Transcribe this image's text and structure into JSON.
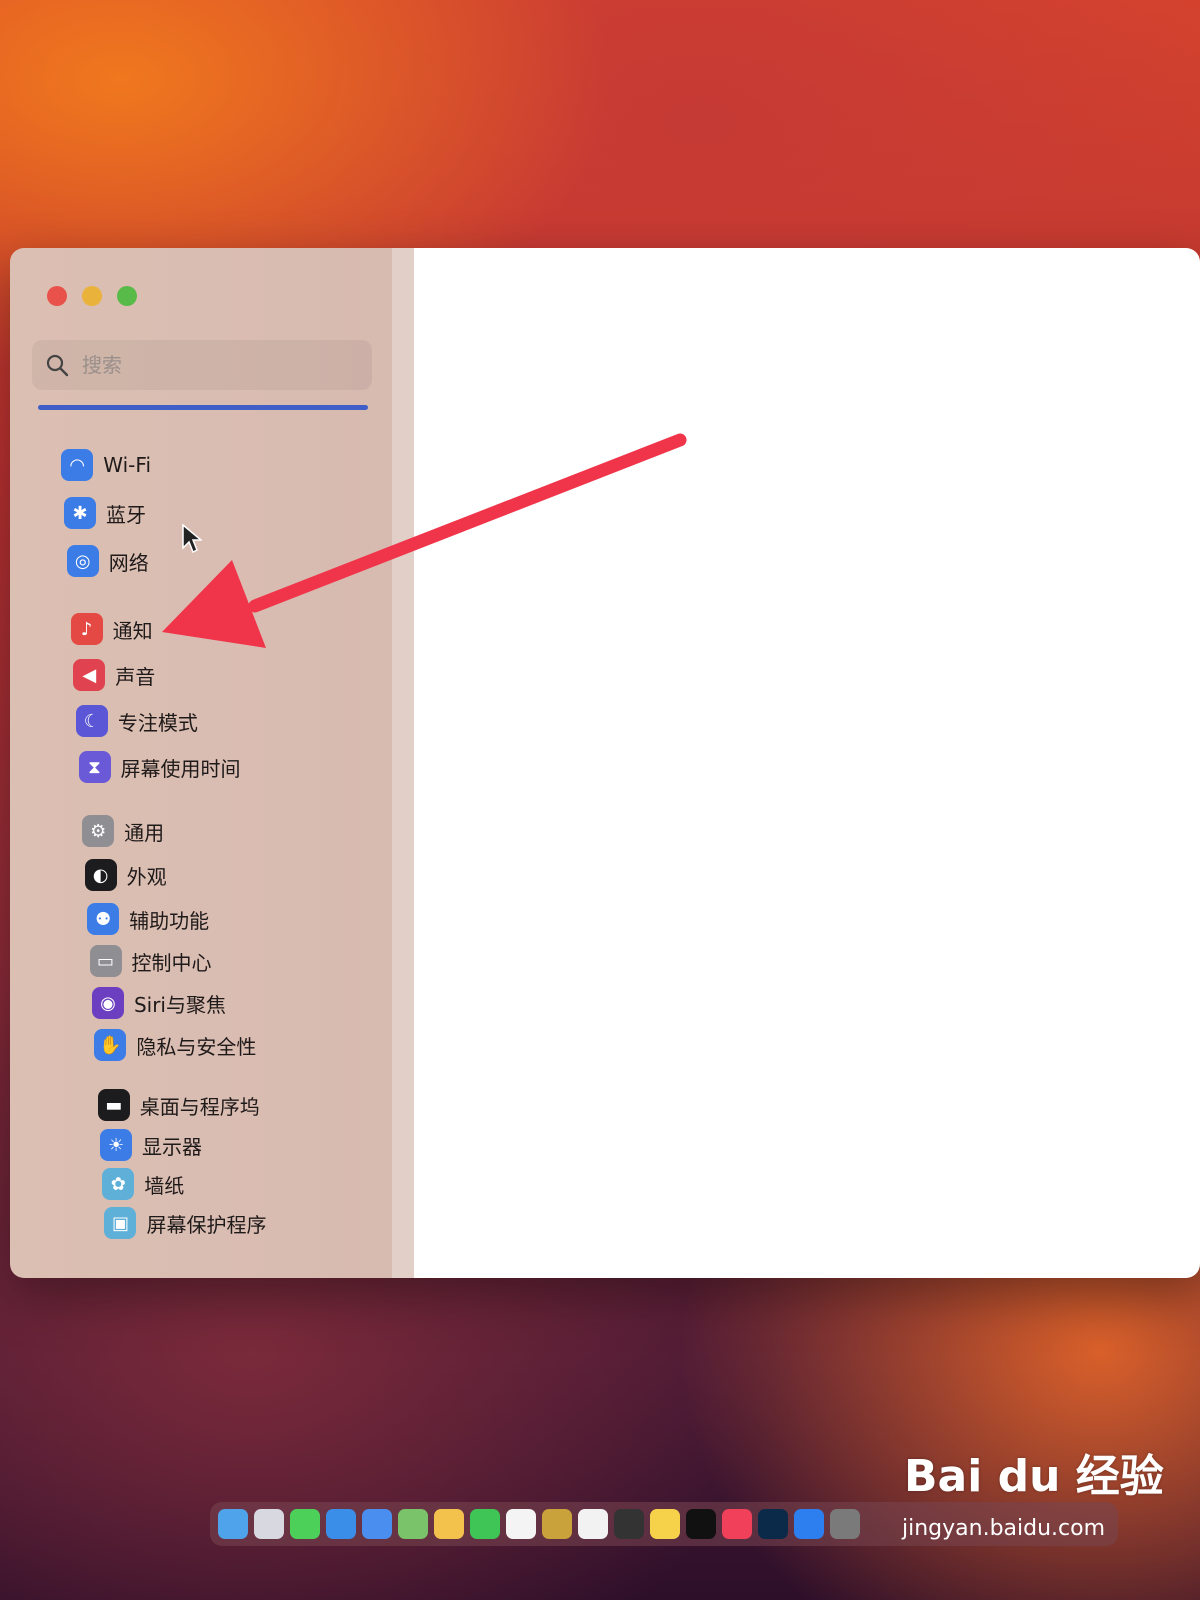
{
  "search": {
    "placeholder": "搜索"
  },
  "sidebar": {
    "items": [
      {
        "label": "Wi-Fi",
        "icon": "wifi-icon",
        "color": "#3c7ce6"
      },
      {
        "label": "蓝牙",
        "icon": "bluetooth-icon",
        "color": "#3c7ce6"
      },
      {
        "label": "网络",
        "icon": "globe-icon",
        "color": "#3c7ce6"
      },
      {
        "label": "通知",
        "icon": "bell-icon",
        "color": "#e44a43"
      },
      {
        "label": "声音",
        "icon": "speaker-icon",
        "color": "#e0434f"
      },
      {
        "label": "专注模式",
        "icon": "moon-icon",
        "color": "#5a56d6"
      },
      {
        "label": "屏幕使用时间",
        "icon": "hourglass-icon",
        "color": "#6a5ad8"
      },
      {
        "label": "通用",
        "icon": "gear-icon",
        "color": "#8e8e93"
      },
      {
        "label": "外观",
        "icon": "appearance-icon",
        "color": "#1c1c1e"
      },
      {
        "label": "辅助功能",
        "icon": "accessibility-icon",
        "color": "#3c7ce6"
      },
      {
        "label": "控制中心",
        "icon": "toggles-icon",
        "color": "#8e8e93"
      },
      {
        "label": "Siri与聚焦",
        "icon": "siri-icon",
        "color": "#6b3fbf"
      },
      {
        "label": "隐私与安全性",
        "icon": "hand-icon",
        "color": "#3c7ce6"
      },
      {
        "label": "桌面与程序坞",
        "icon": "dock-icon",
        "color": "#1c1c1e"
      },
      {
        "label": "显示器",
        "icon": "sun-icon",
        "color": "#3c7ce6"
      },
      {
        "label": "墙纸",
        "icon": "flower-icon",
        "color": "#5fb0d8"
      },
      {
        "label": "屏幕保护程序",
        "icon": "screensaver-icon",
        "color": "#5fb0d8"
      }
    ]
  },
  "watermark": {
    "brand": "Bai du 经验",
    "url": "jingyan.baidu.com"
  },
  "annotation": {
    "arrow_color": "#f0354a"
  }
}
